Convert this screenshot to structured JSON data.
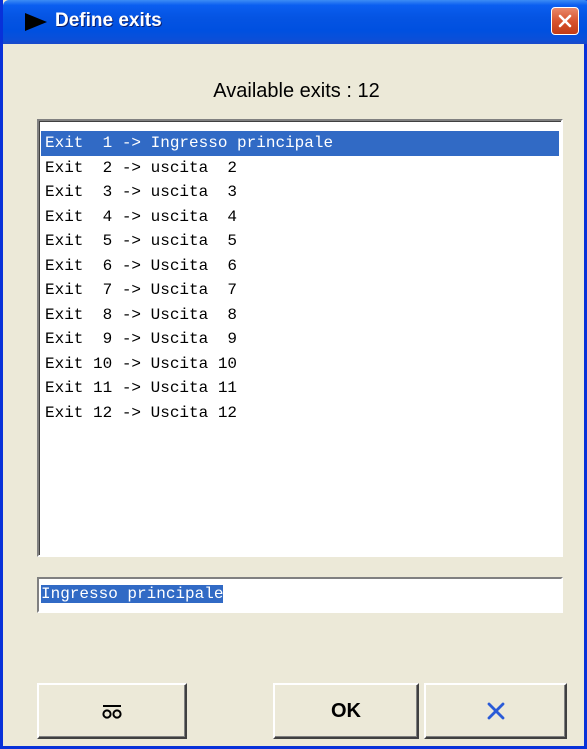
{
  "window": {
    "title": "Define exits",
    "title_icon": "play-triangle-icon",
    "close_icon": "close-icon",
    "accent_color": "#0554e3",
    "close_color": "#d8542f"
  },
  "heading": "Available exits : 12",
  "exits": [
    {
      "text": "Exit  1 -> Ingresso principale",
      "selected": true
    },
    {
      "text": "Exit  2 -> uscita  2",
      "selected": false
    },
    {
      "text": "Exit  3 -> uscita  3",
      "selected": false
    },
    {
      "text": "Exit  4 -> uscita  4",
      "selected": false
    },
    {
      "text": "Exit  5 -> uscita  5",
      "selected": false
    },
    {
      "text": "Exit  6 -> Uscita  6",
      "selected": false
    },
    {
      "text": "Exit  7 -> Uscita  7",
      "selected": false
    },
    {
      "text": "Exit  8 -> Uscita  8",
      "selected": false
    },
    {
      "text": "Exit  9 -> Uscita  9",
      "selected": false
    },
    {
      "text": "Exit 10 -> Uscita 10",
      "selected": false
    },
    {
      "text": "Exit 11 -> Uscita 11",
      "selected": false
    },
    {
      "text": "Exit 12 -> Uscita 12",
      "selected": false
    }
  ],
  "name_field": {
    "value": "Ingresso principale"
  },
  "buttons": {
    "left_icon": "oo-glasses-icon",
    "ok_label": "OK",
    "cancel_icon": "x-cancel-icon",
    "cancel_color": "#2a5bd7"
  },
  "selection_color": "#316ac5"
}
